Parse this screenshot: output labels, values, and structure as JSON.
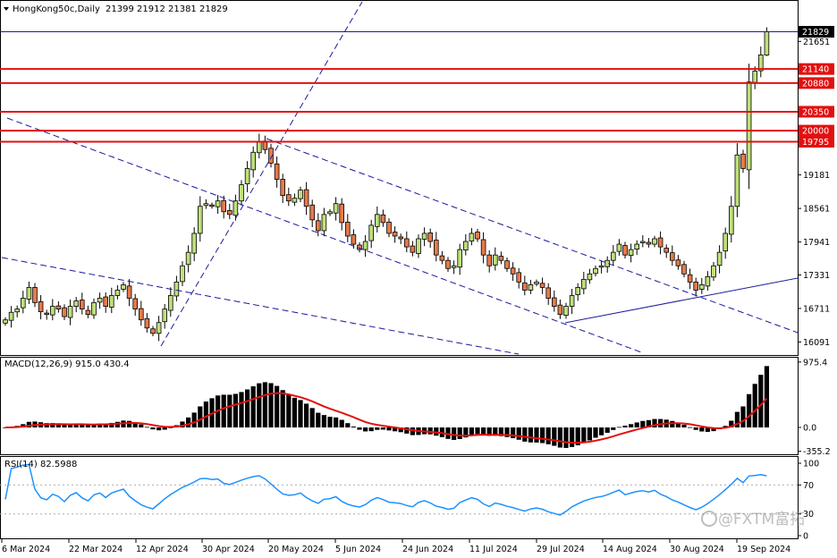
{
  "header": {
    "symbol": "HongKong50c,Daily",
    "ohlc": "21399 21912 21381 21829"
  },
  "watermark": {
    "text": "@FXTM富拓"
  },
  "chart_data": [
    {
      "type": "candlestick",
      "symbol": "HongKong50c",
      "timeframe": "Daily",
      "open": 21399,
      "high": 21912,
      "low": 21381,
      "close": 21829,
      "y_ticks": [
        21651,
        19181,
        18561,
        17941,
        17331,
        16711,
        16091
      ],
      "ylim": [
        15850,
        22400
      ],
      "current_price": 21829,
      "levels": [
        {
          "value": 21140,
          "label": "21140"
        },
        {
          "value": 20880,
          "label": "20880"
        },
        {
          "value": 20350,
          "label": "20350"
        },
        {
          "value": 20000,
          "label": "20000"
        },
        {
          "value": 19795,
          "label": "19795"
        }
      ],
      "x_ticks": [
        "6 Mar 2024",
        "22 Mar 2024",
        "12 Apr 2024",
        "30 Apr 2024",
        "20 May 2024",
        "5 Jun 2024",
        "24 Jun 2024",
        "11 Jul 2024",
        "29 Jul 2024",
        "14 Aug 2024",
        "30 Aug 2024",
        "19 Sep 2024"
      ],
      "closes": [
        16500,
        16640,
        16700,
        16900,
        17100,
        16820,
        16650,
        16600,
        16750,
        16700,
        16560,
        16750,
        16850,
        16700,
        16600,
        16820,
        16900,
        16750,
        16950,
        17050,
        17150,
        16900,
        16700,
        16500,
        16350,
        16250,
        16450,
        16700,
        16950,
        17200,
        17500,
        17750,
        18100,
        18600,
        18650,
        18600,
        18700,
        18500,
        18450,
        18700,
        19000,
        19300,
        19600,
        19800,
        19650,
        19400,
        19100,
        18800,
        18700,
        18750,
        18900,
        18600,
        18350,
        18150,
        18450,
        18500,
        18650,
        18300,
        18050,
        17900,
        17800,
        17950,
        18250,
        18450,
        18300,
        18100,
        18050,
        18000,
        17850,
        17750,
        18000,
        18100,
        17950,
        17700,
        17600,
        17450,
        17500,
        17800,
        17950,
        18100,
        18000,
        17700,
        17500,
        17700,
        17600,
        17450,
        17350,
        17200,
        17050,
        17150,
        17200,
        17100,
        16900,
        16750,
        16600,
        16750,
        16950,
        17100,
        17250,
        17350,
        17450,
        17500,
        17600,
        17750,
        17900,
        17700,
        17800,
        17900,
        17950,
        17900,
        18000,
        17850,
        17750,
        17600,
        17500,
        17350,
        17200,
        17050,
        17150,
        17300,
        17500,
        17750,
        18100,
        18600,
        19550,
        19300,
        20900,
        21100,
        21400,
        21829
      ],
      "series": [
        {
          "name": "MACD(12,26,9)",
          "values": [
            915.0
          ]
        },
        {
          "name": "Signal",
          "values": [
            430.4
          ]
        }
      ],
      "macd": {
        "label": "MACD(12,26,9) 915.0 430.4",
        "main": 915.0,
        "signal": 430.4,
        "y_ticks": [
          975.4,
          0.0,
          -355.2
        ],
        "ylim": [
          -400,
          1040
        ]
      },
      "rsi": {
        "label": "RSI(14) 82.5988",
        "value": 82.5988,
        "y_ticks": [
          100,
          70,
          30,
          0
        ],
        "levels": [
          70,
          30
        ],
        "ylim": [
          0,
          100
        ]
      }
    }
  ]
}
